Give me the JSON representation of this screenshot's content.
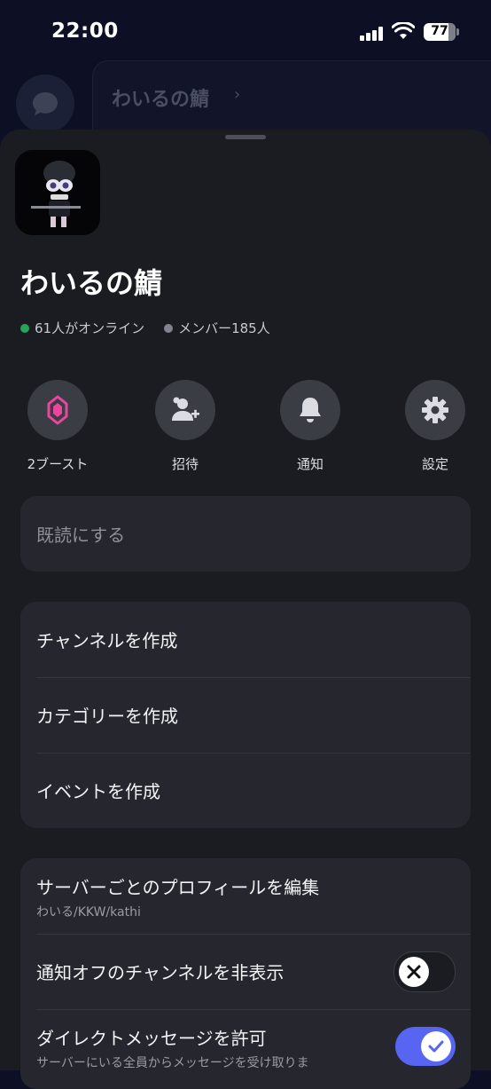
{
  "status_bar": {
    "time": "22:00",
    "battery": "77",
    "battery_level": 0.77
  },
  "background": {
    "server_title": "わいるの鯖"
  },
  "server": {
    "name": "わいるの鯖",
    "online_text": "61人がオンライン",
    "members_text": "メンバー185人"
  },
  "actions": [
    {
      "label": "2ブースト",
      "icon": "boost-icon",
      "color": "#eb459f"
    },
    {
      "label": "招待",
      "icon": "invite-user-icon",
      "color": "#dbdde3"
    },
    {
      "label": "通知",
      "icon": "bell-icon",
      "color": "#dbdde3"
    },
    {
      "label": "設定",
      "icon": "gear-icon",
      "color": "#dbdde3"
    }
  ],
  "mark_read": {
    "label": "既読にする"
  },
  "create_menu": {
    "create_channel": "チャンネルを作成",
    "create_category": "カテゴリーを作成",
    "create_event": "イベントを作成"
  },
  "settings_menu": {
    "edit_profile": {
      "label": "サーバーごとのプロフィールを編集",
      "sub": "わいる/KKW/kathi"
    },
    "hide_muted": {
      "label": "通知オフのチャンネルを非表示",
      "enabled": false
    },
    "allow_dm": {
      "label": "ダイレクトメッセージを許可",
      "sub": "サーバーにいる全員からメッセージを受け取りま",
      "enabled": true
    }
  },
  "colors": {
    "accent": "#5865f2",
    "online": "#23a55a",
    "boost": "#eb459f",
    "sheet": "#1b1c22",
    "card": "#26272e"
  }
}
